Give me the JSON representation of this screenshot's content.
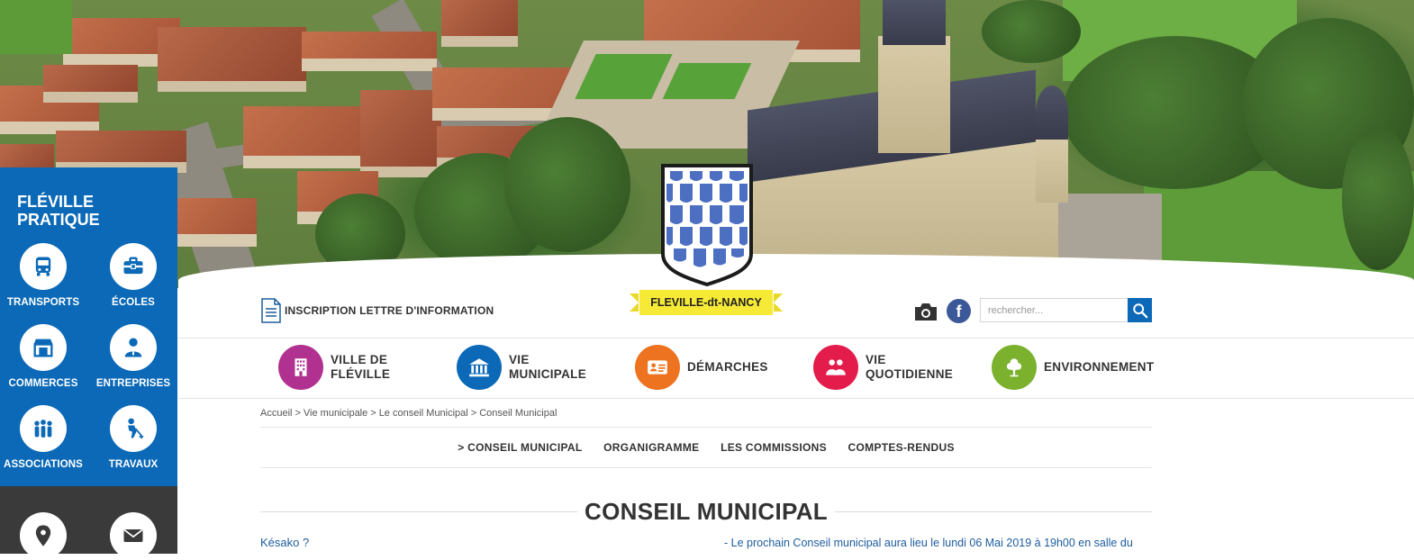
{
  "sidebar": {
    "title_line1": "FLÉVILLE",
    "title_line2": "PRATIQUE",
    "items": [
      {
        "label": "TRANSPORTS",
        "icon": "bus-icon"
      },
      {
        "label": "ÉCOLES",
        "icon": "briefcase-icon"
      },
      {
        "label": "COMMERCES",
        "icon": "shop-icon"
      },
      {
        "label": "ENTREPRISES",
        "icon": "businessman-icon"
      },
      {
        "label": "ASSOCIATIONS",
        "icon": "people-icon"
      },
      {
        "label": "TRAVAUX",
        "icon": "worker-icon"
      }
    ],
    "bottom_items": [
      {
        "icon": "map-pin-icon"
      },
      {
        "icon": "envelope-icon"
      }
    ],
    "color": "#0b69b7",
    "dark_color": "#3a3a3a"
  },
  "header": {
    "newsletter_label": "INSCRIPTION LETTRE D'INFORMATION",
    "town_banner": "FLEVILLE-dt-NANCY",
    "search_placeholder": "rechercher..."
  },
  "menu": [
    {
      "line1": "VILLE DE",
      "line2": "FLÉVILLE",
      "color": "#b0318f",
      "icon": "building-icon"
    },
    {
      "line1": "VIE",
      "line2": "MUNICIPALE",
      "color": "#0b69b7",
      "icon": "town-hall-icon"
    },
    {
      "line1": "DÉMARCHES",
      "line2": "",
      "color": "#ee7320",
      "icon": "id-card-icon"
    },
    {
      "line1": "VIE",
      "line2": "QUOTIDIENNE",
      "color": "#e31c4b",
      "icon": "family-icon"
    },
    {
      "line1": "ENVIRONNEMENT",
      "line2": "",
      "color": "#7bb12d",
      "icon": "tree-icon"
    }
  ],
  "breadcrumb": [
    "Accueil",
    "Vie municipale",
    "Le conseil Municipal",
    "Conseil Municipal"
  ],
  "subnav": [
    "> CONSEIL MUNICIPAL",
    "ORGANIGRAMME",
    "LES COMMISSIONS",
    "COMPTES-RENDUS"
  ],
  "page": {
    "title": "CONSEIL MUNICIPAL",
    "kesako": "Késako ?",
    "notice": "- Le prochain Conseil municipal aura lieu le lundi 06 Mai 2019 à 19h00 en salle du"
  }
}
